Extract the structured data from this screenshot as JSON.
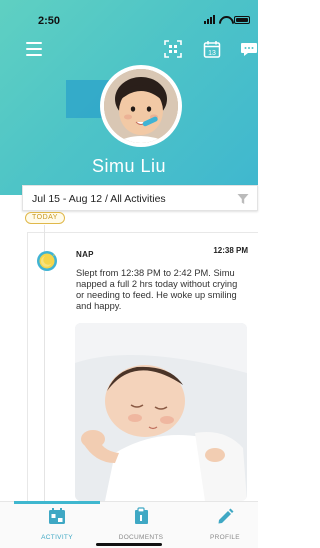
{
  "status_bar": {
    "time": "2:50"
  },
  "header": {
    "child_name": "Simu Liu",
    "icons": [
      "menu-icon",
      "scan-icon",
      "calendar-icon",
      "chat-icon"
    ],
    "calendar_day": "13",
    "accent_color": "#4ec4c7"
  },
  "filter": {
    "label": "Jul 15 - Aug 12 / All Activities",
    "icon": "filter-icon"
  },
  "timeline": {
    "today_label": "TODAY",
    "entries": [
      {
        "type_label": "NAP",
        "time": "12:38 PM",
        "description": "Slept from 12:38 PM to 2:42 PM. Simu napped a full 2 hrs today without crying or needing to feed. He woke up smiling and happy.",
        "icon": "moon-icon"
      }
    ]
  },
  "tabs": [
    {
      "label": "ACTIVITY",
      "icon": "activity-icon",
      "active": true
    },
    {
      "label": "DOCUMENTS",
      "icon": "documents-icon",
      "active": false
    },
    {
      "label": "PROFILE",
      "icon": "profile-icon",
      "active": false
    }
  ]
}
